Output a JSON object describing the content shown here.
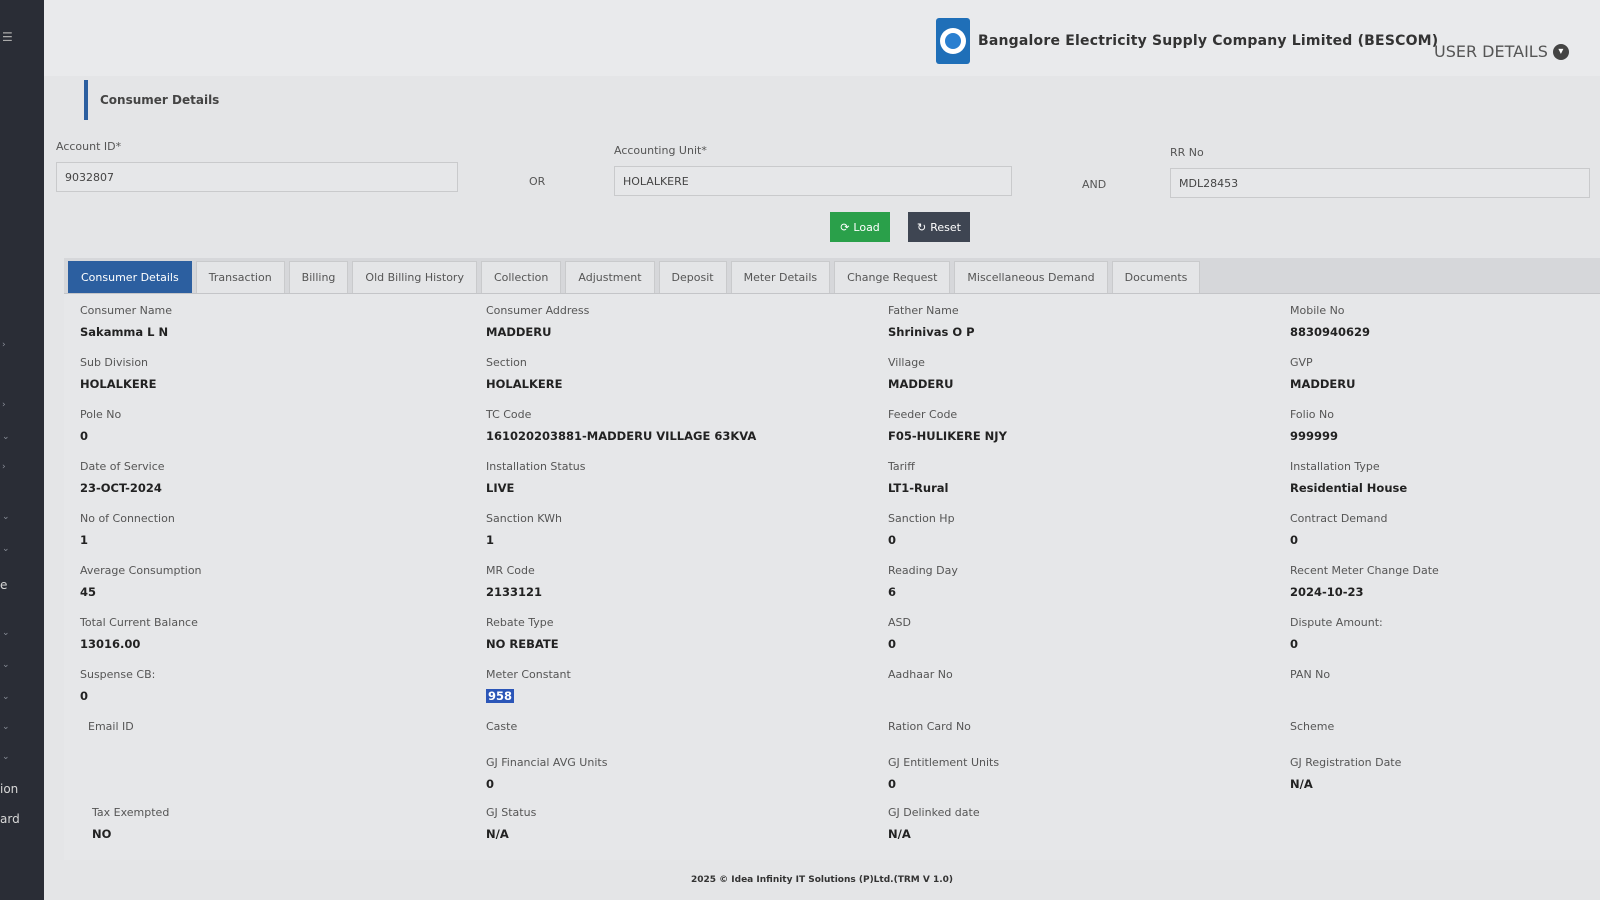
{
  "sidebar": {
    "text1": "ion",
    "text2": "ard",
    "text3": "e"
  },
  "header": {
    "company": "Bangalore Electricity Supply Company Limited (BESCOM)",
    "user_details": "USER DETAILS"
  },
  "section_title": "Consumer Details",
  "search": {
    "account_id_label": "Account ID*",
    "account_id_value": "9032807",
    "or_label": "OR",
    "accounting_unit_label": "Accounting Unit*",
    "accounting_unit_value": "HOLALKERE",
    "and_label": "AND",
    "rr_no_label": "RR No",
    "rr_no_value": "MDL28453",
    "load_label": "Load",
    "reset_label": "Reset"
  },
  "tabs": [
    "Consumer Details",
    "Transaction",
    "Billing",
    "Old Billing History",
    "Collection",
    "Adjustment",
    "Deposit",
    "Meter Details",
    "Change Request",
    "Miscellaneous Demand",
    "Documents"
  ],
  "fields": {
    "consumer_name": {
      "label": "Consumer Name",
      "value": "Sakamma L N"
    },
    "consumer_address": {
      "label": "Consumer Address",
      "value": "MADDERU"
    },
    "father_name": {
      "label": "Father Name",
      "value": "Shrinivas O P"
    },
    "mobile_no": {
      "label": "Mobile No",
      "value": "8830940629"
    },
    "sub_division": {
      "label": "Sub Division",
      "value": "HOLALKERE"
    },
    "section": {
      "label": "Section",
      "value": "HOLALKERE"
    },
    "village": {
      "label": "Village",
      "value": "MADDERU"
    },
    "gvp": {
      "label": "GVP",
      "value": "MADDERU"
    },
    "pole_no": {
      "label": "Pole No",
      "value": "0"
    },
    "tc_code": {
      "label": "TC Code",
      "value": "161020203881-MADDERU VILLAGE 63KVA"
    },
    "feeder_code": {
      "label": "Feeder Code",
      "value": "F05-HULIKERE NJY"
    },
    "folio_no": {
      "label": "Folio No",
      "value": "999999"
    },
    "date_of_service": {
      "label": "Date of Service",
      "value": "23-OCT-2024"
    },
    "installation_status": {
      "label": "Installation Status",
      "value": "LIVE"
    },
    "tariff": {
      "label": "Tariff",
      "value": "LT1-Rural"
    },
    "installation_type": {
      "label": "Installation Type",
      "value": "Residential House"
    },
    "no_of_connection": {
      "label": "No of Connection",
      "value": "1"
    },
    "sanction_kwh": {
      "label": "Sanction KWh",
      "value": "1"
    },
    "sanction_hp": {
      "label": "Sanction Hp",
      "value": "0"
    },
    "contract_demand": {
      "label": "Contract Demand",
      "value": "0"
    },
    "average_consumption": {
      "label": "Average Consumption",
      "value": "45"
    },
    "mr_code": {
      "label": "MR Code",
      "value": "2133121"
    },
    "reading_day": {
      "label": "Reading Day",
      "value": "6"
    },
    "recent_meter_change_date": {
      "label": "Recent Meter Change Date",
      "value": "2024-10-23"
    },
    "total_current_balance": {
      "label": "Total Current Balance",
      "value": "13016.00"
    },
    "rebate_type": {
      "label": "Rebate Type",
      "value": "NO REBATE"
    },
    "asd": {
      "label": "ASD",
      "value": "0"
    },
    "dispute_amount": {
      "label": "Dispute Amount:",
      "value": "0"
    },
    "suspense_cb": {
      "label": "Suspense CB:",
      "value": "0"
    },
    "meter_constant": {
      "label": "Meter Constant",
      "value": "958"
    },
    "aadhaar_no": {
      "label": "Aadhaar No",
      "value": ""
    },
    "pan_no": {
      "label": "PAN No",
      "value": ""
    },
    "email_id": {
      "label": "Email ID",
      "value": ""
    },
    "caste": {
      "label": "Caste",
      "value": ""
    },
    "ration_card_no": {
      "label": "Ration Card No",
      "value": ""
    },
    "scheme": {
      "label": "Scheme",
      "value": ""
    },
    "gj_financial_avg_units": {
      "label": "GJ Financial AVG Units",
      "value": "0"
    },
    "gj_entitlement_units": {
      "label": "GJ Entitlement Units",
      "value": "0"
    },
    "gj_registration_date": {
      "label": "GJ Registration Date",
      "value": "N/A"
    },
    "tax_exempted": {
      "label": "Tax Exempted",
      "value": "NO"
    },
    "gj_status": {
      "label": "GJ Status",
      "value": "N/A"
    },
    "gj_delinked_date": {
      "label": "GJ Delinked date",
      "value": "N/A"
    }
  },
  "footer": "2025 © Idea Infinity IT Solutions (P)Ltd.(TRM V 1.0)"
}
